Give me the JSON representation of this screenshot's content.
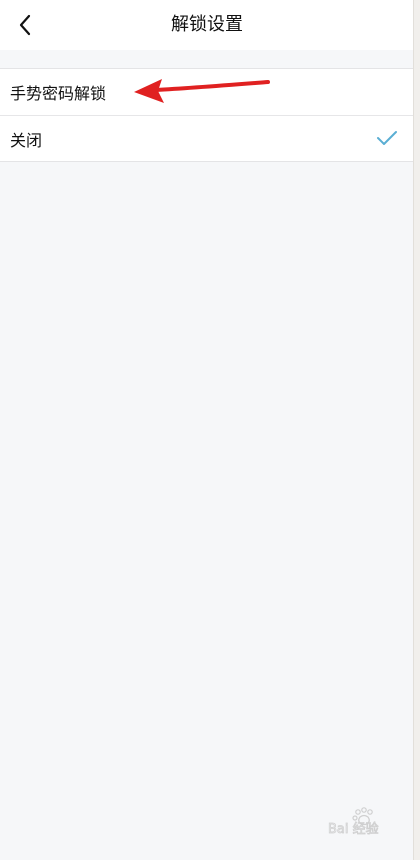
{
  "header": {
    "title": "解锁设置",
    "back_icon": "chevron-left-icon"
  },
  "options": [
    {
      "label": "手势密码解锁",
      "selected": false
    },
    {
      "label": "关闭",
      "selected": true,
      "check_icon": "checkmark-icon"
    }
  ],
  "colors": {
    "check": "#5aaed3",
    "annotation_arrow": "#e02121",
    "background": "#f6f7f9"
  },
  "watermark": {
    "text": "Bai 经验",
    "icon": "paw-logo-icon"
  }
}
